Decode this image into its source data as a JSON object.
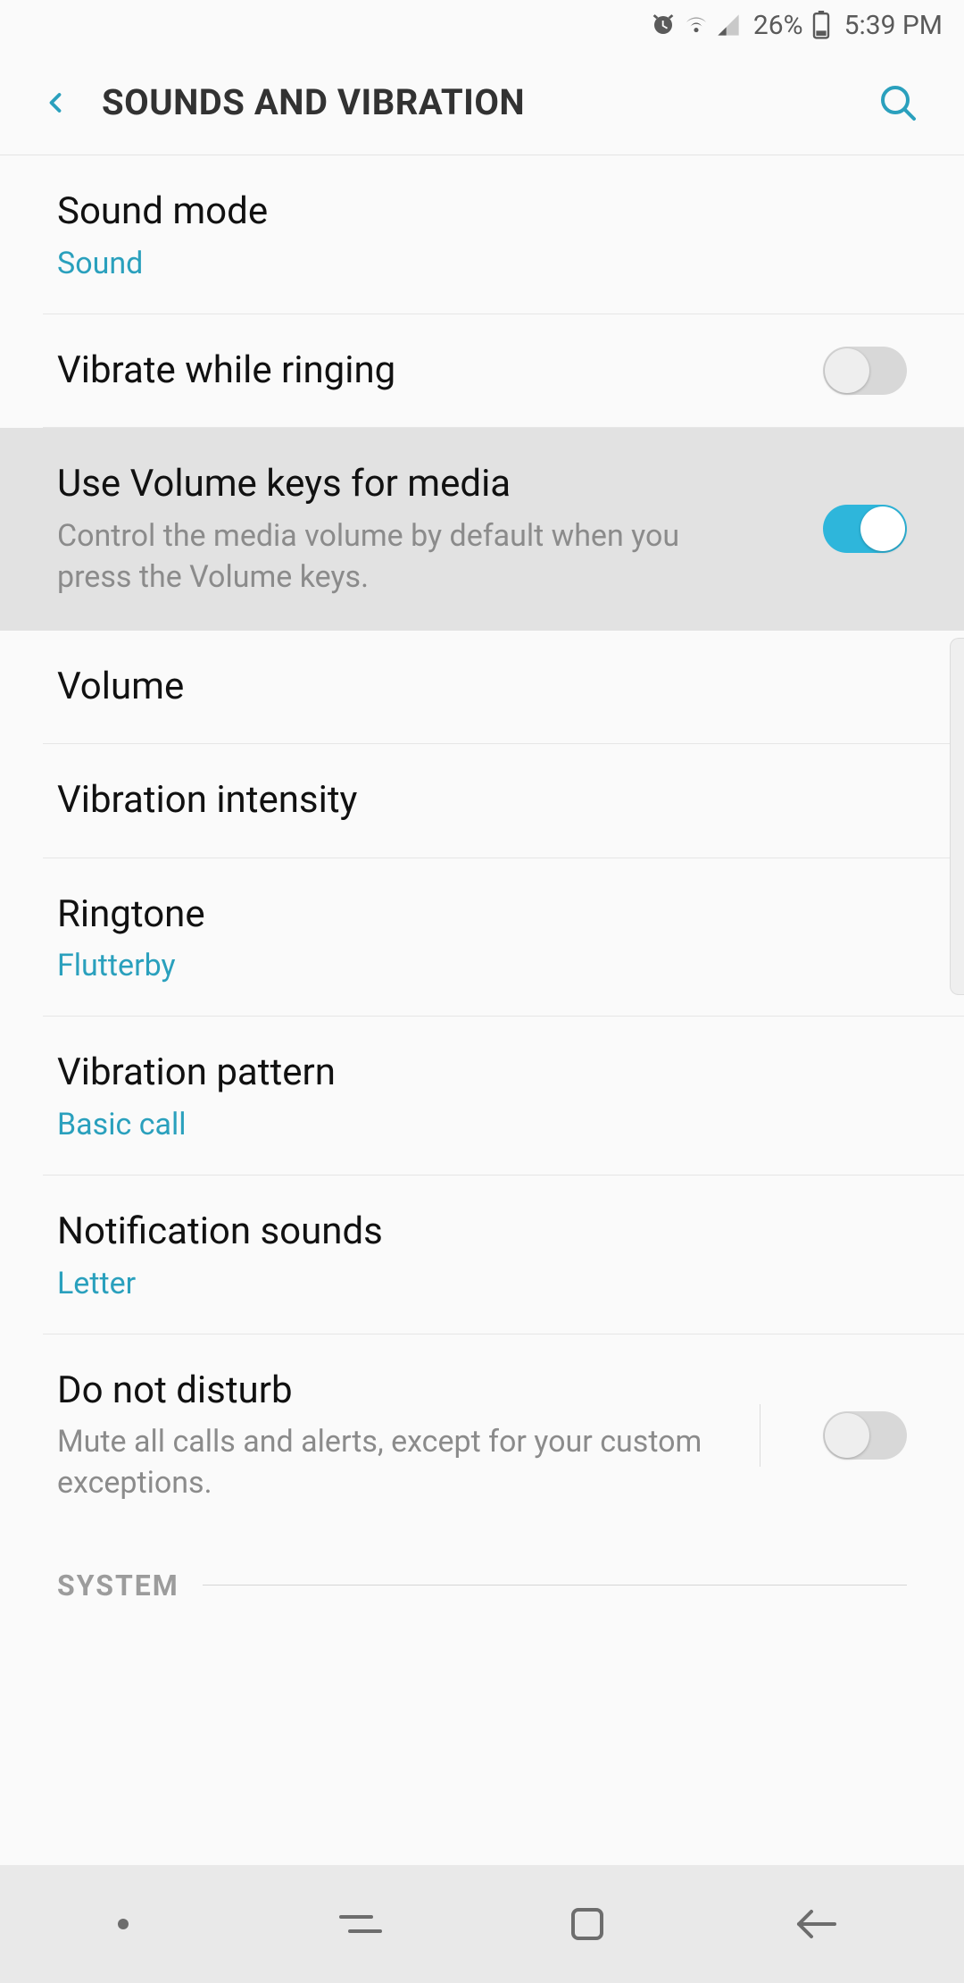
{
  "status": {
    "battery_pct": "26%",
    "time": "5:39 PM"
  },
  "header": {
    "title": "SOUNDS AND VIBRATION"
  },
  "settings": {
    "sound_mode": {
      "title": "Sound mode",
      "value": "Sound"
    },
    "vibrate_ringing": {
      "title": "Vibrate while ringing",
      "on": false
    },
    "vol_keys_media": {
      "title": "Use Volume keys for media",
      "desc": "Control the media volume by default when you press the Volume keys.",
      "on": true
    },
    "volume": {
      "title": "Volume"
    },
    "vib_intensity": {
      "title": "Vibration intensity"
    },
    "ringtone": {
      "title": "Ringtone",
      "value": "Flutterby"
    },
    "vib_pattern": {
      "title": "Vibration pattern",
      "value": "Basic call"
    },
    "notif_sounds": {
      "title": "Notification sounds",
      "value": "Letter"
    },
    "dnd": {
      "title": "Do not disturb",
      "desc": "Mute all calls and alerts, except for your custom exceptions.",
      "on": false
    }
  },
  "section": {
    "system": "SYSTEM"
  },
  "colors": {
    "accent": "#2aa0bd",
    "toggle_on": "#2eb6db"
  }
}
